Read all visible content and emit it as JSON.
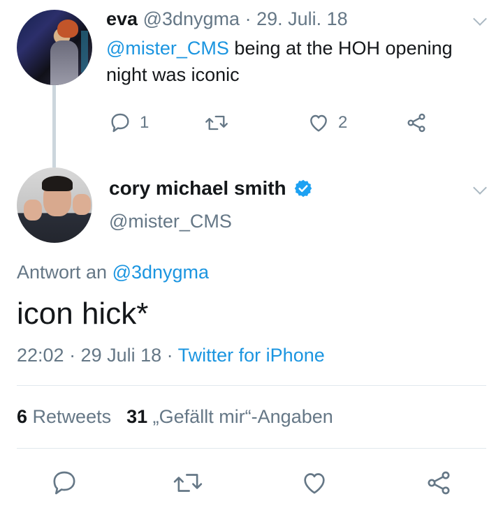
{
  "parent_tweet": {
    "name": "eva",
    "handle": "@3dnygma",
    "date": "· 29. Juli. 18",
    "mention": "@mister_CMS",
    "text": " being at the HOH opening night was iconic",
    "reply_count": "1",
    "like_count": "2"
  },
  "main_tweet": {
    "name": "cory michael smith",
    "handle": "@mister_CMS",
    "reply_prefix": "Antwort an ",
    "reply_target": "@3dnygma",
    "text": "icon hick*",
    "timestamp": "22:02 · 29 Juli 18 · ",
    "source": "Twitter for iPhone",
    "retweet_count": "6",
    "retweet_label": "Retweets",
    "like_count": "31",
    "like_label": "„Gefällt mir“-Angaben"
  },
  "colors": {
    "accent": "#1b95e0",
    "muted": "#657786",
    "text": "#14171a",
    "divider": "#e1e8ed"
  },
  "icons": [
    "reply-icon",
    "retweet-icon",
    "like-icon",
    "share-icon",
    "verified-badge-icon",
    "chevron-down-icon"
  ]
}
